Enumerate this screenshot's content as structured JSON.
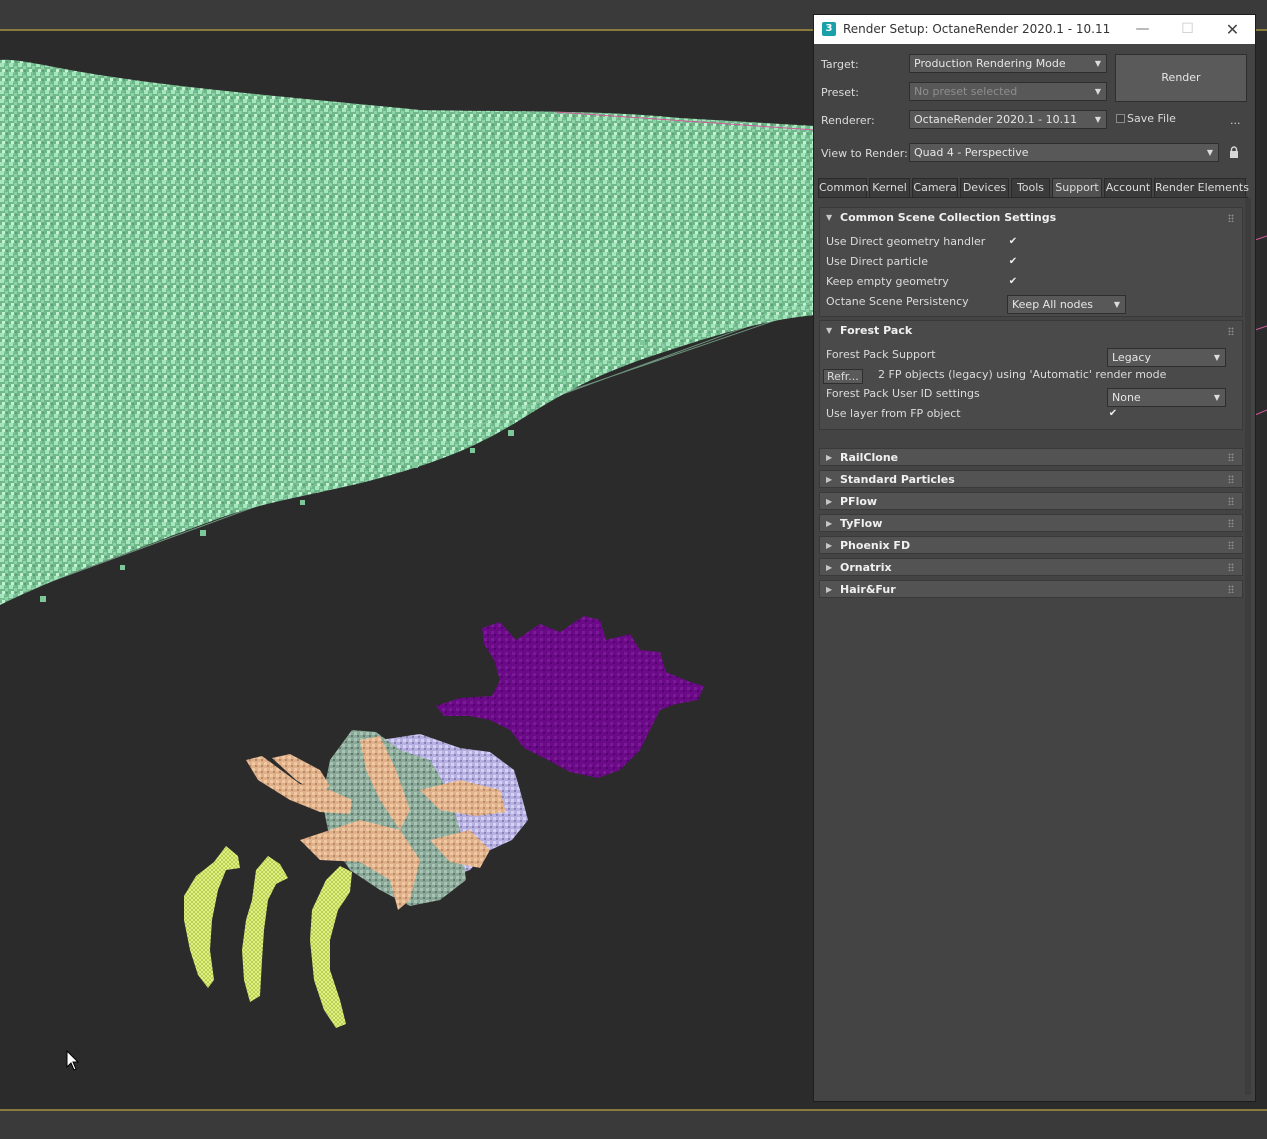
{
  "dialog": {
    "title": "Render Setup: OctaneRender 2020.1 - 10.11",
    "icon_text": "3",
    "window_controls": {
      "minimize": "—",
      "maximize": "☐",
      "close": "✕"
    }
  },
  "form": {
    "target_label": "Target:",
    "target_value": "Production Rendering Mode",
    "preset_label": "Preset:",
    "preset_value": "No preset selected",
    "renderer_label": "Renderer:",
    "renderer_value": "OctaneRender 2020.1 - 10.11",
    "save_file_label": "Save File",
    "more_label": "...",
    "view_label": "View to Render:",
    "view_value": "Quad 4 - Perspective",
    "render_button": "Render"
  },
  "tabs": [
    {
      "label": "Common"
    },
    {
      "label": "Kernel"
    },
    {
      "label": "Camera"
    },
    {
      "label": "Devices"
    },
    {
      "label": "Tools"
    },
    {
      "label": "Support",
      "active": true
    },
    {
      "label": "Account"
    },
    {
      "label": "Render Elements"
    }
  ],
  "common_scene": {
    "title": "Common Scene Collection Settings",
    "use_direct_geometry_label": "Use Direct geometry handler",
    "use_direct_geometry_checked": true,
    "use_direct_particle_label": "Use Direct particle",
    "use_direct_particle_checked": true,
    "keep_empty_geometry_label": "Keep empty geometry",
    "keep_empty_geometry_checked": true,
    "persistency_label": "Octane Scene Persistency",
    "persistency_value": "Keep All nodes"
  },
  "forest_pack": {
    "title": "Forest Pack",
    "support_label": "Forest Pack Support",
    "support_value": "Legacy",
    "refresh_button": "Refr...",
    "status_text": "2 FP objects (legacy) using 'Automatic' render mode",
    "user_id_label": "Forest Pack User ID settings",
    "user_id_value": "None",
    "use_layer_label": "Use layer from FP object",
    "use_layer_checked": true
  },
  "collapsed_rollouts": [
    {
      "title": "RailClone"
    },
    {
      "title": "Standard Particles"
    },
    {
      "title": "PFlow"
    },
    {
      "title": "TyFlow"
    },
    {
      "title": "Phoenix FD"
    },
    {
      "title": "Ornatrix"
    },
    {
      "title": "Hair&Fur"
    }
  ],
  "colors": {
    "viewport_bg": "#2b2b2b",
    "grass": "#8fd4a8",
    "purple": "#6a0a86",
    "peach": "#e0b08a",
    "lavender": "#b6b0e0",
    "sage": "#8aa898",
    "lime": "#c8e060",
    "accent_gold": "#8a7a3c"
  },
  "icons": {
    "dropdown": "▼",
    "expanded": "▼",
    "collapsed": "▶",
    "check": "✔"
  }
}
